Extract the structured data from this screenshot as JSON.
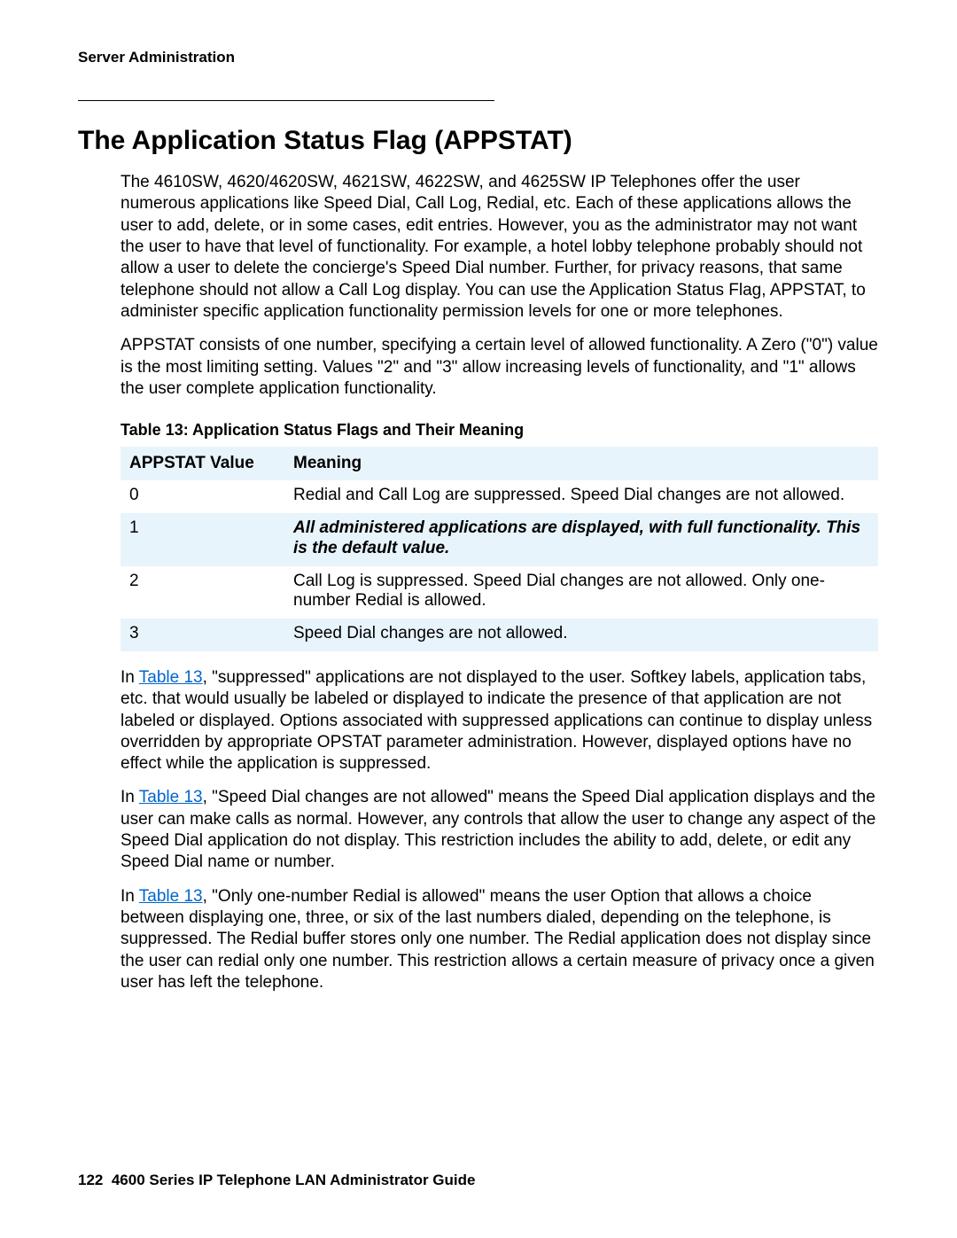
{
  "header": {
    "running_head": "Server Administration"
  },
  "section": {
    "title": "The Application Status Flag (APPSTAT)",
    "para1": "The 4610SW, 4620/4620SW, 4621SW, 4622SW, and 4625SW IP Telephones offer the user numerous applications like Speed Dial, Call Log, Redial, etc. Each of these applications allows the user to add, delete, or in some cases, edit entries. However, you as the administrator may not want the user to have that level of functionality. For example, a hotel lobby telephone probably should not allow a user to delete the concierge's Speed Dial number. Further, for privacy reasons, that same telephone should not allow a Call Log display. You can use the Application Status Flag, APPSTAT, to administer specific application functionality permission levels for one or more telephones.",
    "para2": "APPSTAT consists of one number, specifying a certain level of allowed functionality. A Zero (\"0\") value is the most limiting setting. Values \"2\" and \"3\" allow increasing levels of functionality, and \"1\" allows the user complete application functionality."
  },
  "table": {
    "caption": "Table 13: Application Status Flags and Their Meaning",
    "headers": {
      "value": "APPSTAT Value",
      "meaning": "Meaning"
    },
    "rows": [
      {
        "value": "0",
        "meaning": "Redial and Call Log are suppressed. Speed Dial changes are not allowed.",
        "shade": true,
        "emph": false
      },
      {
        "value": "1",
        "meaning": "All administered applications are displayed, with full functionality. This is the default value.",
        "shade": false,
        "emph": true
      },
      {
        "value": "2",
        "meaning": "Call Log is suppressed. Speed Dial changes are not allowed. Only one-number Redial is allowed.",
        "shade": true,
        "emph": false
      },
      {
        "value": "3",
        "meaning": "Speed Dial changes are not allowed.",
        "shade": false,
        "emph": false
      }
    ]
  },
  "after_table": {
    "ref_label": "Table 13",
    "p1a": "In ",
    "p1b": ", \"suppressed\" applications are not displayed to the user. Softkey labels, application tabs, etc. that would usually be labeled or displayed to indicate the presence of that application are not labeled or displayed. Options associated with suppressed applications can continue to display unless overridden by appropriate OPSTAT parameter administration. However, displayed options have no effect while the application is suppressed.",
    "p2a": "In ",
    "p2b": ", \"Speed Dial changes are not allowed\" means the Speed Dial application displays and the user can make calls as normal. However, any controls that allow the user to change any aspect of the Speed Dial application do not display. This restriction includes the ability to add, delete, or edit any Speed Dial name or number.",
    "p3a": "In ",
    "p3b": ", \"Only one-number Redial is allowed\" means the user Option that allows a choice between displaying one, three, or six of the last numbers dialed, depending on the telephone, is suppressed. The Redial buffer stores only one number. The Redial application does not display since the user can redial only one number. This restriction allows a certain measure of privacy once a given user has left the telephone."
  },
  "footer": {
    "page_number": "122",
    "doc_title": "4600 Series IP Telephone LAN Administrator Guide"
  }
}
